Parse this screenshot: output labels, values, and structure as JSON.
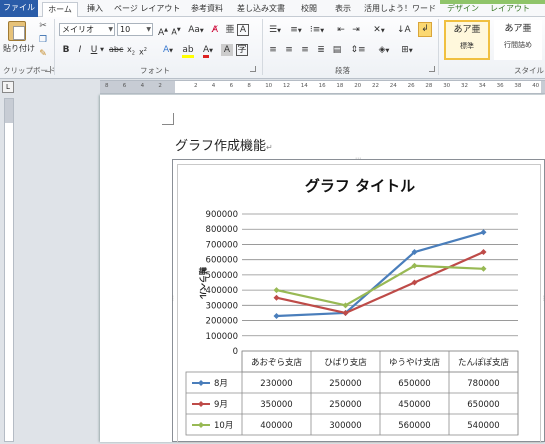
{
  "ribbon": {
    "tabs": [
      {
        "id": "file",
        "label": "ファイル"
      },
      {
        "id": "home",
        "label": "ホーム"
      },
      {
        "id": "insert",
        "label": "挿入"
      },
      {
        "id": "page-layout",
        "label": "ページ レイアウト"
      },
      {
        "id": "references",
        "label": "参考資料"
      },
      {
        "id": "mailings",
        "label": "差し込み文書"
      },
      {
        "id": "review",
        "label": "校閲"
      },
      {
        "id": "view",
        "label": "表示"
      },
      {
        "id": "addin",
        "label": "活用しよう！ワード"
      },
      {
        "id": "design",
        "label": "デザイン"
      },
      {
        "id": "layout",
        "label": "レイアウト"
      }
    ],
    "clipboard": {
      "paste_label": "貼り付け",
      "group_label": "クリップボード"
    },
    "font": {
      "name": "メイリオ",
      "size": "10",
      "group_label": "フォント"
    },
    "paragraph": {
      "group_label": "段落"
    },
    "styles": {
      "group_label": "スタイル",
      "items": [
        {
          "preview": "あア亜",
          "name": "標準"
        },
        {
          "preview": "あア亜",
          "name": "行間詰め"
        }
      ]
    }
  },
  "ruler": {
    "corner": "L",
    "numbers": [
      "8",
      "6",
      "4",
      "2",
      "",
      "2",
      "4",
      "6",
      "8",
      "10",
      "12",
      "14",
      "16",
      "18",
      "20",
      "22",
      "24",
      "26",
      "28",
      "30",
      "32",
      "34",
      "36",
      "38",
      "40"
    ]
  },
  "document": {
    "heading": "グラフ作成機能",
    "para_mark": "↵"
  },
  "chart_data": {
    "type": "line",
    "title": "グラフ タイトル",
    "ylabel": "軸ラベル",
    "xlabel": "",
    "categories": [
      "あおぞら支店",
      "ひばり支店",
      "ゆうやけ支店",
      "たんぽぽ支店"
    ],
    "y_ticks": [
      "900000",
      "800000",
      "700000",
      "600000",
      "500000",
      "400000",
      "300000",
      "200000",
      "100000",
      "0"
    ],
    "ylim": [
      0,
      900000
    ],
    "grid": true,
    "legend": "data-table",
    "series": [
      {
        "name": "8月",
        "color": "#4a7ebb",
        "values": [
          230000,
          250000,
          650000,
          780000
        ]
      },
      {
        "name": "9月",
        "color": "#be4b48",
        "values": [
          350000,
          250000,
          450000,
          650000
        ]
      },
      {
        "name": "10月",
        "color": "#98b954",
        "values": [
          400000,
          300000,
          560000,
          540000
        ]
      }
    ]
  }
}
